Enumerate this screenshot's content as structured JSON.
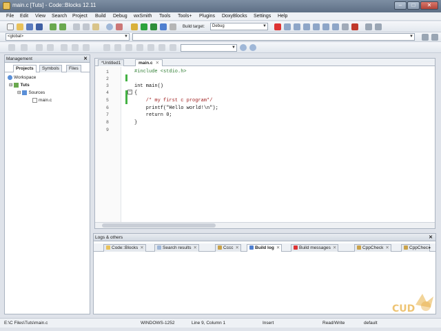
{
  "window": {
    "title": "main.c [Tuts] - Code::Blocks 12.11"
  },
  "menu": [
    "File",
    "Edit",
    "View",
    "Search",
    "Project",
    "Build",
    "Debug",
    "wxSmith",
    "Tools",
    "Tools+",
    "Plugins",
    "DoxyBlocks",
    "Settings",
    "Help"
  ],
  "toolbar": {
    "build_target_label": "Build target:",
    "build_target_value": "Debug",
    "scope_value": "<global>"
  },
  "management": {
    "title": "Management",
    "tabs": [
      "Projects",
      "Symbols",
      "Files"
    ],
    "tree": {
      "workspace": "Workspace",
      "project": "Tuts",
      "folder": "Sources",
      "file": "main.c"
    }
  },
  "editor": {
    "tabs": [
      {
        "label": "*Untitled1"
      },
      {
        "label": "main.c"
      }
    ],
    "line_numbers": [
      "1",
      "2",
      "3",
      "4",
      "5",
      "6",
      "7",
      "8",
      "9"
    ],
    "lines": [
      "#include <stdio.h>",
      "",
      "int main()",
      "{",
      "    /* my first c program*/",
      "    printf(\"Hello world!\\n\");",
      "    return 0;",
      "}",
      ""
    ]
  },
  "logs": {
    "title": "Logs & others",
    "tabs": [
      "Code::Blocks",
      "Search results",
      "Cccc",
      "Build log",
      "Build messages",
      "CppCheck",
      "CppChec"
    ]
  },
  "status": {
    "path": "E:\\C Files\\Tuts\\main.c",
    "encoding": "WINDOWS-1252",
    "position": "Line 9, Column 1",
    "mode": "Insert",
    "access": "Read/Write",
    "profile": "default"
  },
  "watermark": {
    "text": "CUD"
  },
  "colors": {
    "titlebar": "#6e7f95",
    "accent_green": "#44b244",
    "preprocessor": "#2e7d32",
    "comment": "#a02020",
    "string": "#7a2a9a"
  }
}
